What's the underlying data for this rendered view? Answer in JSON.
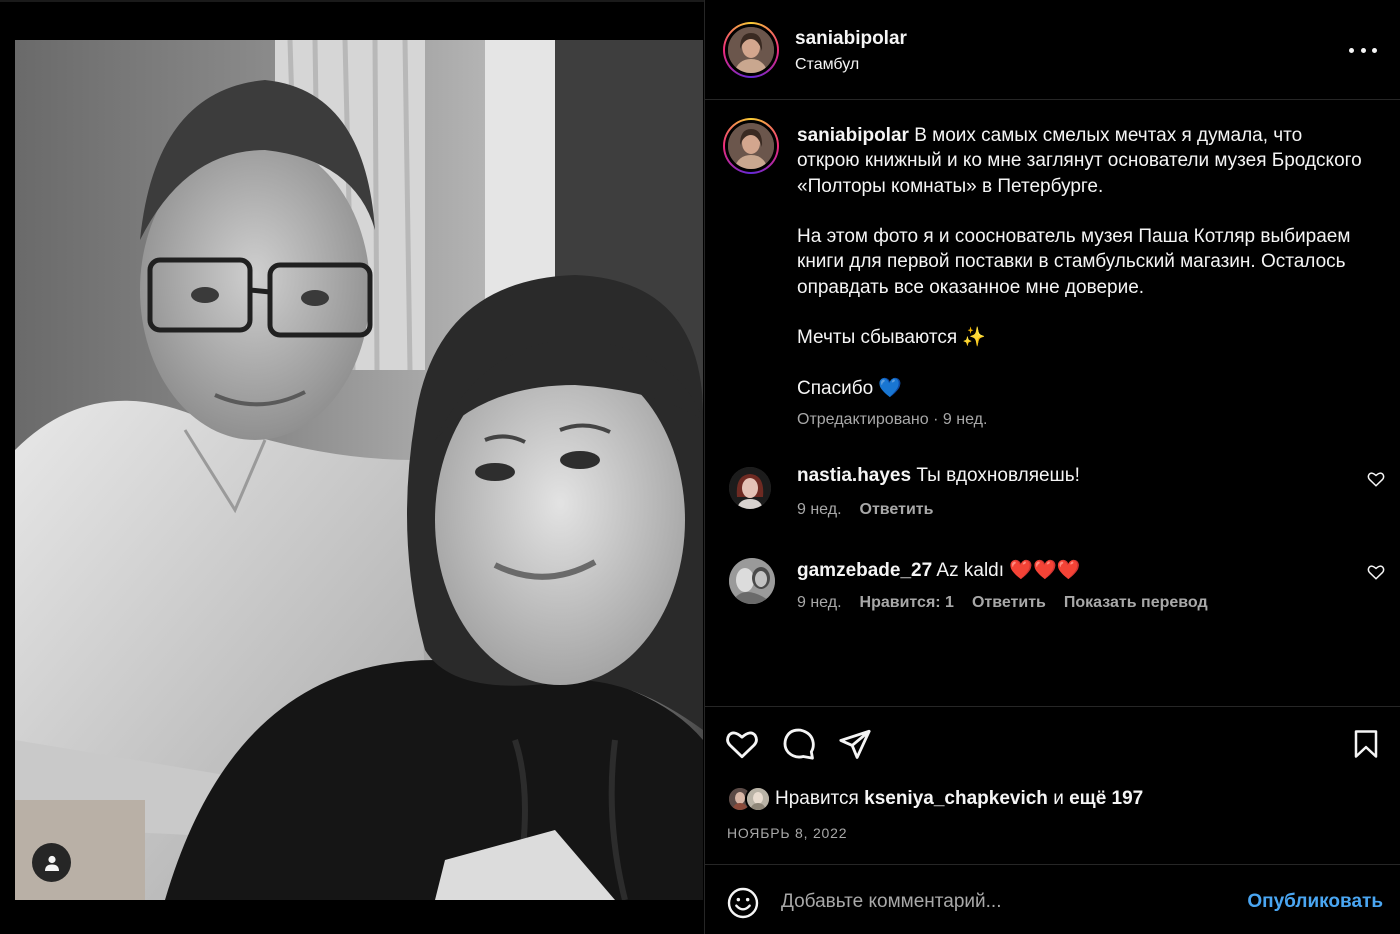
{
  "post": {
    "username": "saniabipolar",
    "location": "Стамбул"
  },
  "caption": {
    "username": "saniabipolar",
    "paragraphs": [
      "В моих самых смелых мечтах я думала, что открою книжный и ко мне заглянут основатели музея Бродского «Полторы комнаты» в Петербурге.",
      "На этом фото я и сооснователь музея Паша Котляр выбираем книги для первой поставки в стамбульский магазин. Осталось оправдать все оказанное мне доверие.",
      "Мечты сбываются ✨",
      "Спасибо 💙"
    ],
    "edited": "Отредактировано",
    "separator": "·",
    "time": "9 нед."
  },
  "comments": [
    {
      "username": "nastia.hayes",
      "text": "Ты вдохновляешь!",
      "time": "9 нед.",
      "reply": "Ответить"
    },
    {
      "username": "gamzebade_27",
      "text": "Az kaldı ❤️❤️❤️",
      "time": "9 нед.",
      "likes": "Нравится: 1",
      "reply": "Ответить",
      "translate": "Показать перевод"
    }
  ],
  "likes": {
    "prefix": "Нравится",
    "user": "kseniya_chapkevich",
    "middle": "и",
    "others": "ещё 197"
  },
  "date": "НОЯБРЬ 8, 2022",
  "comment_box": {
    "placeholder": "Добавьте комментарий...",
    "publish": "Опубликовать"
  },
  "colors": {
    "background": "#000000",
    "text": "#f5f5f5",
    "secondary": "#a8a8a8",
    "link": "#4aa6f2",
    "divider": "#262626"
  },
  "icons": [
    "user-tag-icon",
    "more-options-icon",
    "heart-icon",
    "comment-icon",
    "share-icon",
    "bookmark-icon",
    "emoji-icon"
  ]
}
